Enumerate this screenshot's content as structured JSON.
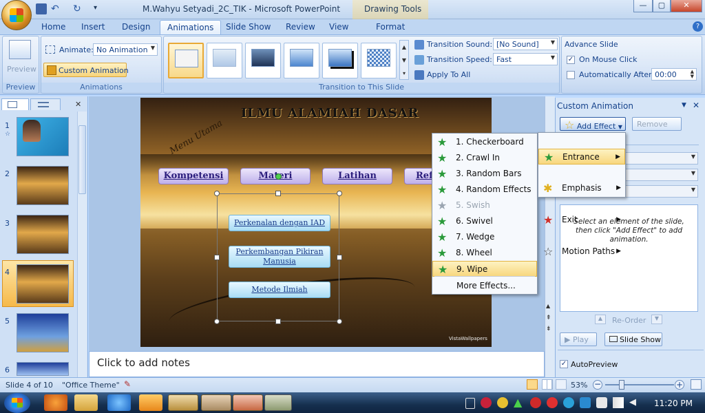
{
  "window": {
    "title": "M.Wahyu Setyadi_2C_TIK - Microsoft PowerPoint",
    "context_tab_title": "Drawing Tools",
    "minimize": "—",
    "maximize": "▢",
    "close": "✕"
  },
  "tabs": [
    "Home",
    "Insert",
    "Design",
    "Animations",
    "Slide Show",
    "Review",
    "View",
    "Format"
  ],
  "active_tab": "Animations",
  "ribbon": {
    "preview_group": {
      "label": "Preview",
      "button": "Preview"
    },
    "animations_group": {
      "label": "Animations",
      "animate_label": "Animate:",
      "animate_value": "No Animation",
      "custom_animation": "Custom Animation"
    },
    "transition_group": {
      "label": "Transition to This Slide",
      "sound_label": "Transition Sound:",
      "sound_value": "[No Sound]",
      "speed_label": "Transition Speed:",
      "speed_value": "Fast",
      "apply_all": "Apply To All"
    },
    "advance_group": {
      "title": "Advance Slide",
      "on_mouse_click": "On Mouse Click",
      "on_mouse_click_checked": true,
      "auto_after": "Automatically After:",
      "auto_after_checked": false,
      "auto_time": "00:00"
    }
  },
  "slides_panel": {
    "numbers": [
      "1",
      "2",
      "3",
      "4",
      "5",
      "6"
    ],
    "selected": "4"
  },
  "slide": {
    "title": "ILMU ALAMIAH DASAR",
    "menu_label": "Menu Utama",
    "nav_buttons": [
      "Kompetensi",
      "Materi",
      "Latihan",
      "Ref"
    ],
    "links": [
      "Perkenalan dengan IAD",
      "Perkembangan Pikiran Manusia",
      "Metode Ilmiah"
    ],
    "watermark": "VistaWallpapers"
  },
  "notes_placeholder": "Click to add notes",
  "effects_menu": {
    "items": [
      {
        "label": "1. Checkerboard",
        "disabled": false,
        "highlighted": false
      },
      {
        "label": "2. Crawl In",
        "disabled": false,
        "highlighted": false
      },
      {
        "label": "3. Random Bars",
        "disabled": false,
        "highlighted": false
      },
      {
        "label": "4. Random Effects",
        "disabled": false,
        "highlighted": false
      },
      {
        "label": "5. Swish",
        "disabled": true,
        "highlighted": false
      },
      {
        "label": "6. Swivel",
        "disabled": false,
        "highlighted": false
      },
      {
        "label": "7. Wedge",
        "disabled": false,
        "highlighted": false
      },
      {
        "label": "8. Wheel",
        "disabled": false,
        "highlighted": false
      },
      {
        "label": "9. Wipe",
        "disabled": false,
        "highlighted": true
      }
    ],
    "more": "More Effects..."
  },
  "add_effect_menu": {
    "items": [
      "Entrance",
      "Emphasis",
      "Exit",
      "Motion Paths"
    ],
    "selected": "Entrance"
  },
  "task_pane": {
    "title": "Custom Animation",
    "add_effect": "Add Effect",
    "remove": "Remove",
    "hint": "Select an element of the slide, then click \"Add Effect\" to add animation.",
    "reorder": "Re-Order",
    "play": "Play",
    "slide_show": "Slide Show",
    "autopreview": "AutoPreview",
    "autopreview_checked": true
  },
  "status": {
    "slide_info": "Slide 4 of 10",
    "theme": "\"Office Theme\"",
    "zoom": "53%"
  },
  "zoom_level": 0.53,
  "taskbar": {
    "clock": "11:20 PM"
  },
  "colors": {
    "ribbon_bg": "#c7daf3",
    "accent": "#15428b",
    "highlight": "#f8d77e"
  }
}
